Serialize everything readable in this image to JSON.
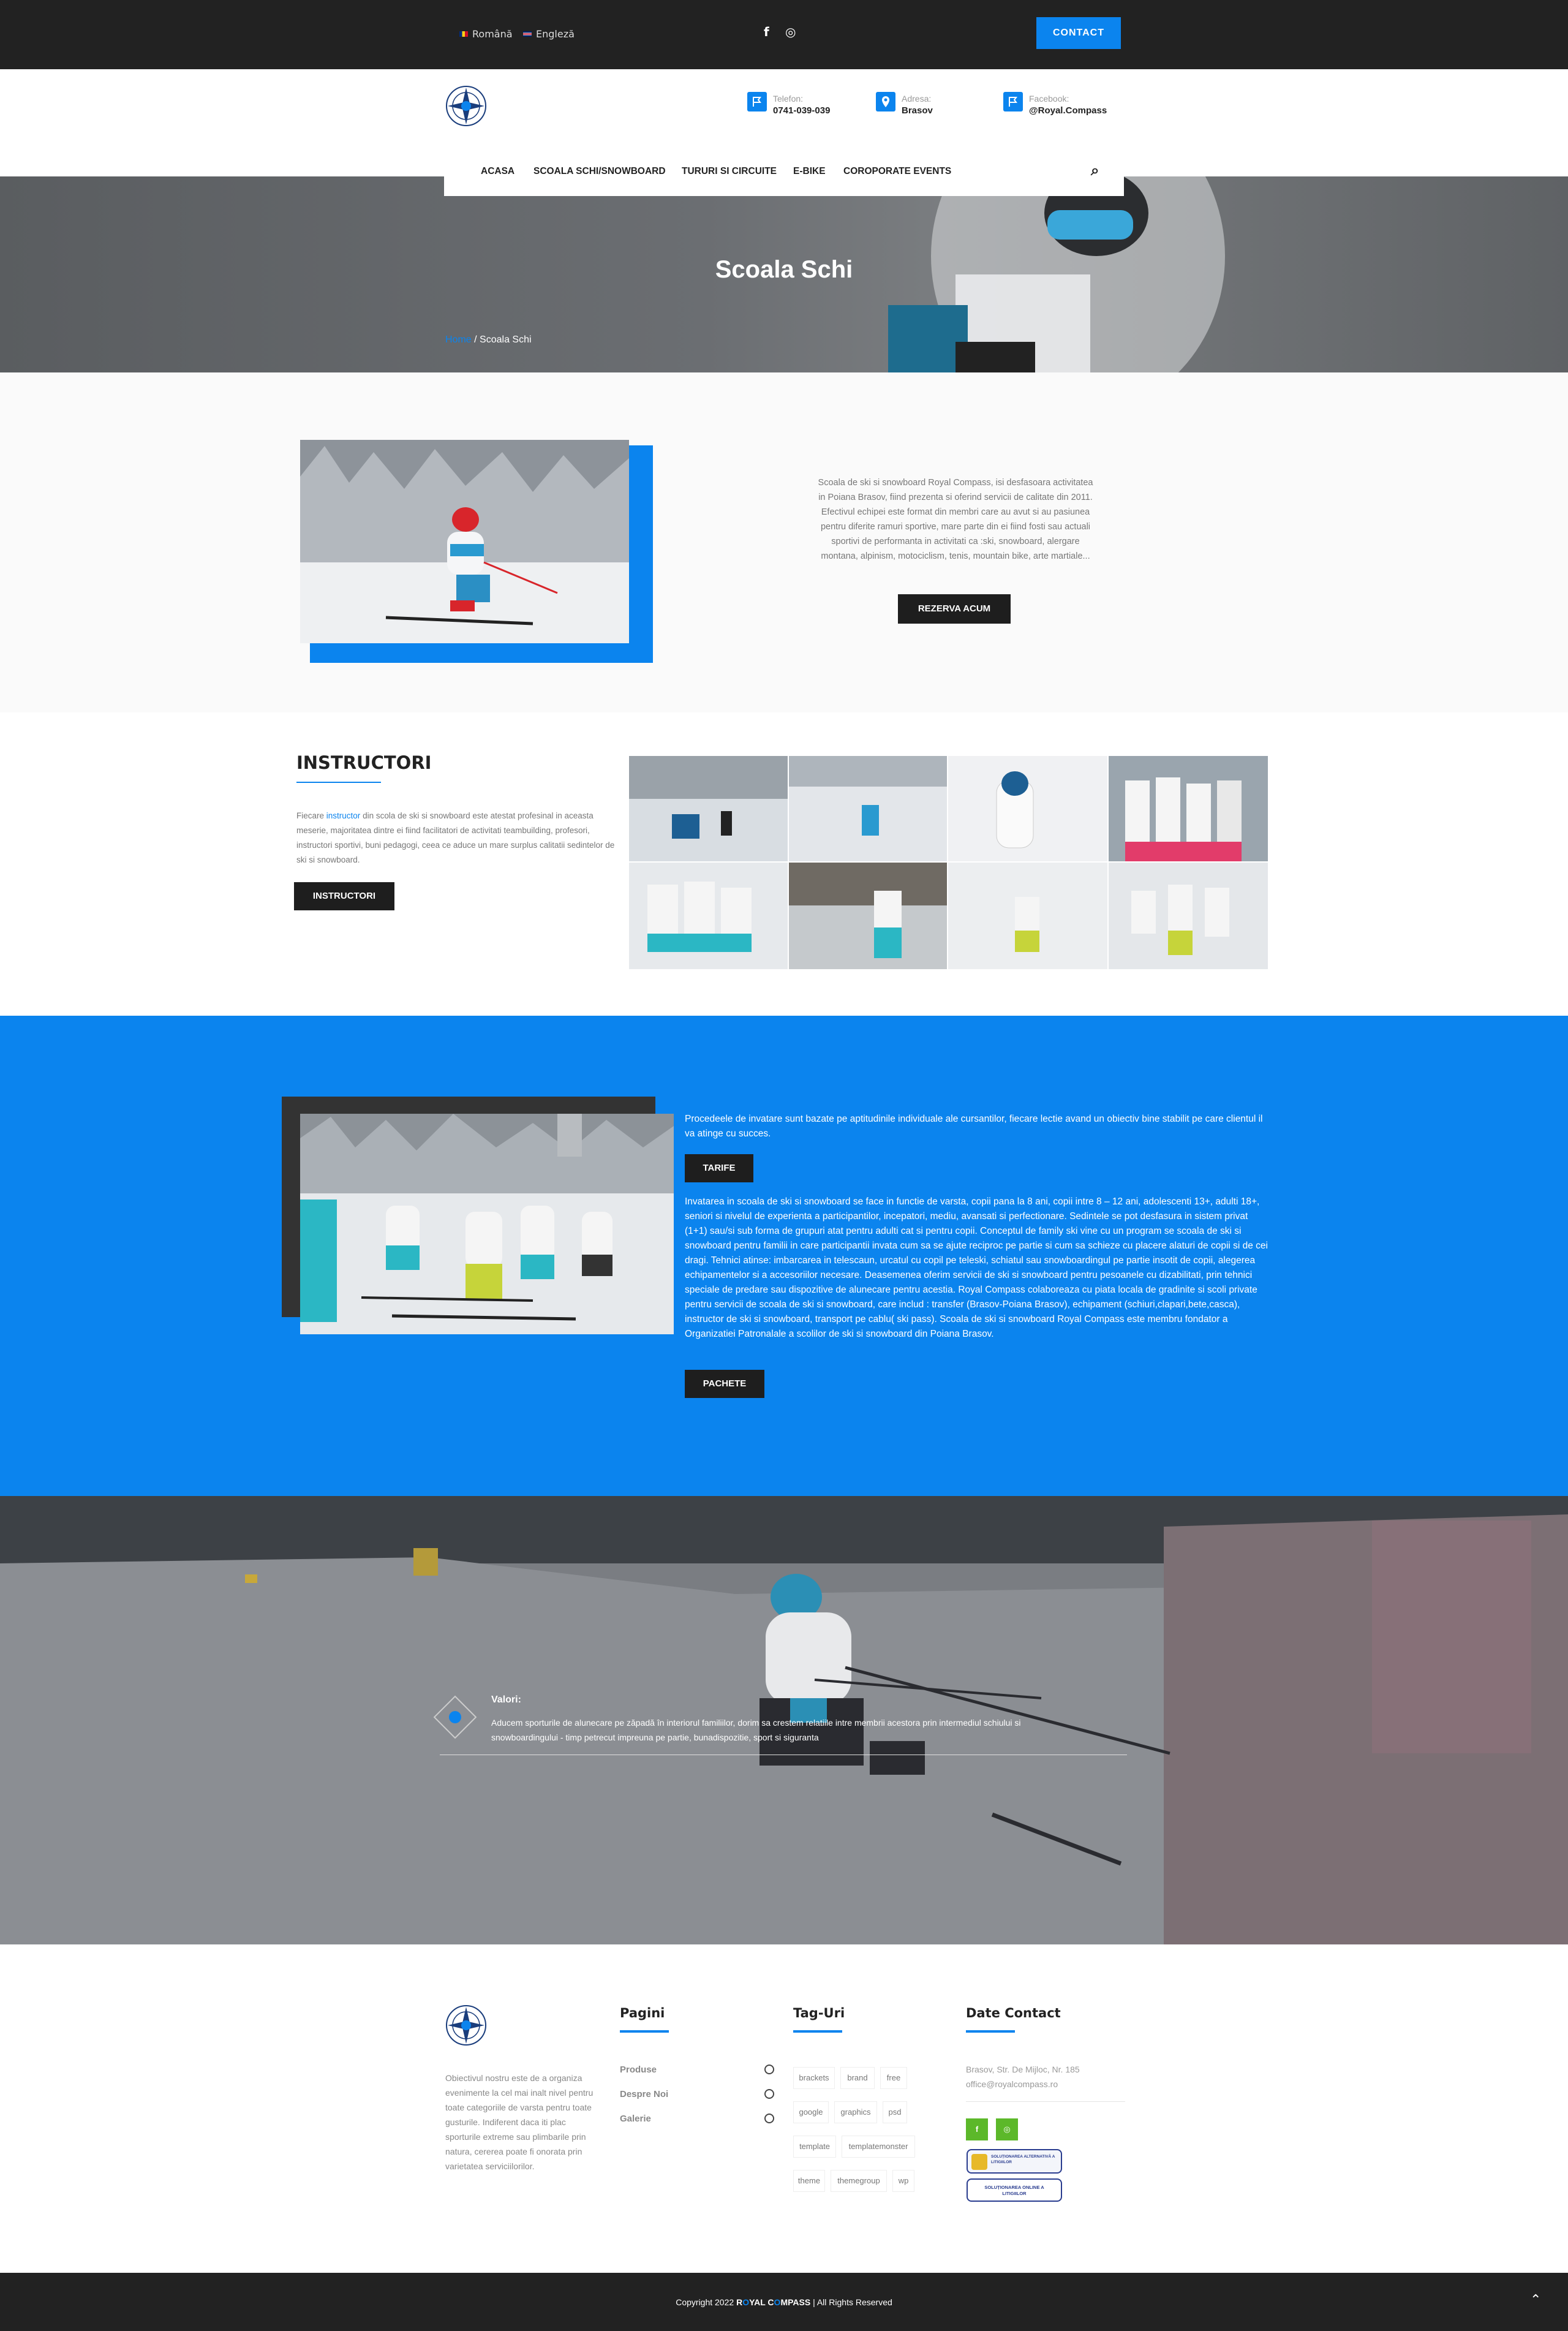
{
  "topbar": {
    "lang_ro": "Română",
    "lang_en": "Engleză",
    "facebook_icon": "f",
    "instagram_icon": "◎",
    "contact_label": "CONTACT"
  },
  "header": {
    "phone_label": "Telefon:",
    "phone_value": "0741-039-039",
    "address_label": "Adresa:",
    "address_value": "Brasov",
    "facebook_label": "Facebook:",
    "facebook_value": "@Royal.Compass"
  },
  "nav": {
    "items": [
      "ACASA",
      "SCOALA SCHI/SNOWBOARD",
      "TURURI SI CIRCUITE",
      "E-BIKE",
      "COROPORATE EVENTS"
    ],
    "search_icon": "⌕"
  },
  "hero": {
    "title": "Scoala Schi",
    "breadcrumb_home": "Home",
    "breadcrumb_sep": "/",
    "breadcrumb_current": "Scoala Schi"
  },
  "intro": {
    "text": "Scoala de ski si snowboard Royal Compass, isi desfasoara activitatea in Poiana Brasov, fiind prezenta si oferind servicii de calitate din 2011. Efectivul echipei este format din membri care au avut si au pasiunea pentru diferite ramuri sportive, mare parte din ei fiind fosti sau actuali sportivi de performanta in activitati ca :ski, snowboard, alergare montana, alpinism, motociclism, tenis, mountain bike, arte martiale...",
    "button": "REZERVA ACUM"
  },
  "instructors": {
    "title": "INSTRUCTORI",
    "text_before": "Fiecare ",
    "text_link": "instructor",
    "text_after": " din scola de ski si snowboard este atestat profesinal in aceasta meserie, majoritatea dintre ei fiind facilitatori de activitati teambuilding, profesori, instructori sportivi, buni pedagogi, ceea ce aduce un mare surplus calitatii sedintelor de ski si snowboard.",
    "button": "INSTRUCTORI"
  },
  "methods": {
    "paragraph1": "Procedeele de invatare sunt bazate pe aptitudinile individuale ale cursantilor, fiecare lectie avand un obiectiv bine stabilit pe care clientul il va atinge cu succes.",
    "button1": "TARIFE",
    "paragraph2": "Invatarea in scoala de ski si snowboard se face in functie de varsta, copii pana la 8 ani, copii intre 8 – 12 ani, adolescenti 13+, adulti 18+,  seniori  si nivelul de experienta a participantilor, incepatori, mediu, avansati si perfectionare. Sedintele se pot desfasura  in sistem privat (1+1) sau/si sub forma de grupuri atat pentru adulti cat si pentru copii. Conceptul de family ski vine cu un program se scoala de ski si snowboard pentru familii in care participantii invata cum sa se ajute reciproc pe partie si cum sa schieze cu placere alaturi de copii si de cei dragi. Tehnici atinse: imbarcarea in telescaun, urcatul cu copil pe teleski, schiatul sau snowboardingul pe partie insotit de copii, alegerea echipamentelor si a accesoriilor necesare. Deasemenea oferim servicii de ski si snowboard pentru pesoanele cu dizabilitati, prin tehnici speciale de predare sau dispozitive de alunecare pentru acestia. Royal Compass colaboreaza cu piata locala de gradinite si scoli private pentru servicii de scoala de ski si snowboard, care includ : transfer (Brasov-Poiana Brasov), echipament (schiuri,clapari,bete,casca), instructor de ski si snowboard, transport pe cablu( ski pass). Scoala de ski si snowboard Royal Compass este membru fondator a Organizatiei Patronalale a scolilor de ski si snowboard din Poiana Brasov.",
    "button2": "PACHETE"
  },
  "values": {
    "title": "Valori:",
    "text": "Aducem sporturile de alunecare pe zăpadă în interiorul familiilor, dorim sa crestem relatiile intre membrii acestora prin intermediul schiului si snowboardingului - timp petrecut impreuna pe partie, bunadispozitie, sport si siguranta"
  },
  "footer": {
    "about": "Obiectivul nostru este de a organiza evenimente la cel mai inalt nivel pentru toate categoriile de varsta pentru toate gusturile. Indiferent daca iti plac sporturile extreme sau plimbarile prin natura, cererea poate fi onorata prin varietatea serviciilorilor.",
    "pages_title": "Pagini",
    "pages": [
      "Produse",
      "Despre Noi",
      "Galerie"
    ],
    "tags_title": "Tag-Uri",
    "tags": [
      "brackets",
      "brand",
      "free",
      "google",
      "graphics",
      "psd",
      "template",
      "templatemonster",
      "theme",
      "themegroup",
      "wp"
    ],
    "contact_title": "Date Contact",
    "address": "Brasov, Str. De Mijloc, Nr. 185",
    "email": "office@royalcompass.ro",
    "anpc_sal": "SOLUȚIONAREA ALTERNATIVĂ A LITIGIILOR",
    "anpc_sol": "SOLUȚIONAREA ONLINE A LITIGIILOR"
  },
  "bottom": {
    "copyright_prefix": "Copyright 2022 ",
    "brand_r": "R",
    "brand_o1": "O",
    "brand_mid": "YAL C",
    "brand_o2": "O",
    "brand_end": "MPASS",
    "copyright_suffix": " | All Rights Reserved",
    "scroll_icon": "⌃"
  },
  "colors": {
    "accent": "#0b84ee",
    "dark": "#222222",
    "button": "#1e1e1e"
  }
}
